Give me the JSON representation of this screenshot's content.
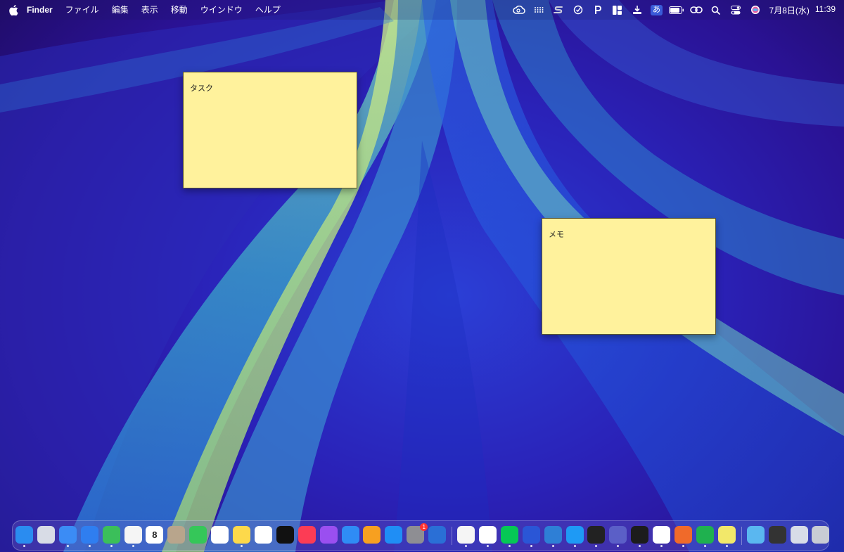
{
  "menubar": {
    "apple_icon": "apple-logo-icon",
    "app_name": "Finder",
    "menus": [
      "ファイル",
      "編集",
      "表示",
      "移動",
      "ウインドウ",
      "ヘルプ"
    ],
    "status_icons": [
      "creative-cloud-icon",
      "grid-dots-icon",
      "s-icon",
      "check-circle-icon",
      "p-icon",
      "layout-icon",
      "download-icon",
      "input-method-icon",
      "battery-icon",
      "link-icon",
      "search-icon",
      "control-center-icon",
      "siri-icon"
    ],
    "input_method_label": "あ",
    "date": "7月8日(水)",
    "time": "11:39"
  },
  "stickies": [
    {
      "text": "タスク"
    },
    {
      "text": "メモ"
    }
  ],
  "dock": {
    "apps": [
      {
        "name": "finder",
        "color": "#2a8cf0",
        "running": true
      },
      {
        "name": "launchpad",
        "color": "#d8dce6",
        "running": false
      },
      {
        "name": "mail",
        "color": "#3b8cf5",
        "running": true
      },
      {
        "name": "safari",
        "color": "#2f7ef0",
        "running": true
      },
      {
        "name": "maps",
        "color": "#3bbf5a",
        "running": true
      },
      {
        "name": "photos",
        "color": "#f5f5f5",
        "running": true
      },
      {
        "name": "calendar",
        "color": "#ffffff",
        "running": false,
        "label": "8"
      },
      {
        "name": "contacts",
        "color": "#b8a58c",
        "running": false
      },
      {
        "name": "facetime",
        "color": "#35c759",
        "running": false
      },
      {
        "name": "reminders",
        "color": "#ffffff",
        "running": false
      },
      {
        "name": "notes",
        "color": "#fdd94b",
        "running": true
      },
      {
        "name": "freeform",
        "color": "#ffffff",
        "running": false
      },
      {
        "name": "tv",
        "color": "#111111",
        "running": false
      },
      {
        "name": "music",
        "color": "#fc3c55",
        "running": false
      },
      {
        "name": "podcasts",
        "color": "#9a4ff0",
        "running": false
      },
      {
        "name": "keynote",
        "color": "#2f8cf5",
        "running": false
      },
      {
        "name": "pages",
        "color": "#f7a020",
        "running": false
      },
      {
        "name": "app-store",
        "color": "#1f8ef5",
        "running": false
      },
      {
        "name": "system-settings",
        "color": "#8e8e93",
        "running": false,
        "badge": "1"
      },
      {
        "name": "iphone-mirroring",
        "color": "#2a6fd6",
        "running": false
      },
      {
        "name": "stickies-app",
        "color": "#f5f5f5",
        "running": true
      },
      {
        "name": "chrome",
        "color": "#ffffff",
        "running": true
      },
      {
        "name": "line",
        "color": "#06c755",
        "running": true
      },
      {
        "name": "tasks",
        "color": "#2a56d6",
        "running": true
      },
      {
        "name": "robot-app",
        "color": "#2e7fd6",
        "running": true
      },
      {
        "name": "q-app",
        "color": "#1e9af5",
        "running": true
      },
      {
        "name": "tour-app",
        "color": "#222222",
        "running": true
      },
      {
        "name": "teams",
        "color": "#5b5fc7",
        "running": true
      },
      {
        "name": "terminal",
        "color": "#1c1c1c",
        "running": true
      },
      {
        "name": "d-app",
        "color": "#ffffff",
        "running": true
      },
      {
        "name": "sunburst-app",
        "color": "#f06a2a",
        "running": true
      },
      {
        "name": "numbers",
        "color": "#1fb14f",
        "running": true
      },
      {
        "name": "stickies-notes",
        "color": "#f2e86a",
        "running": true
      }
    ],
    "right_items": [
      {
        "name": "folder",
        "color": "#5ab7f0"
      },
      {
        "name": "desktop-stack",
        "color": "#333333"
      },
      {
        "name": "window-stack",
        "color": "#d8dce8"
      },
      {
        "name": "trash",
        "color": "#c8ccd4"
      }
    ]
  }
}
